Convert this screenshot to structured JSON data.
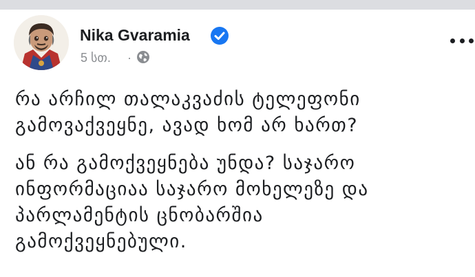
{
  "post": {
    "author_name": "Nika Gvaramia",
    "timestamp": "5 სთ.",
    "separator": "·",
    "privacy_icon": "globe-icon",
    "verified_icon": "verified-badge-icon",
    "more_icon": "more-options-icon",
    "paragraphs": [
      {
        "lines": [
          "რა არჩილ თალაკვაძის ტელეფონი",
          "გამოვაქვეყნე, ავად ხომ არ ხართ?"
        ]
      },
      {
        "lines": [
          "ან რა გამოქვეყნება უნდა? საჯარო",
          "ინფორმაციაა საჯარო მოხელეზე და",
          "პარლამენტის ცნობარშია",
          "გამოქვეყნებული."
        ]
      }
    ]
  },
  "colors": {
    "verified_blue": "#1877f2",
    "text": "#1c1e21",
    "meta": "#8a8d91"
  }
}
